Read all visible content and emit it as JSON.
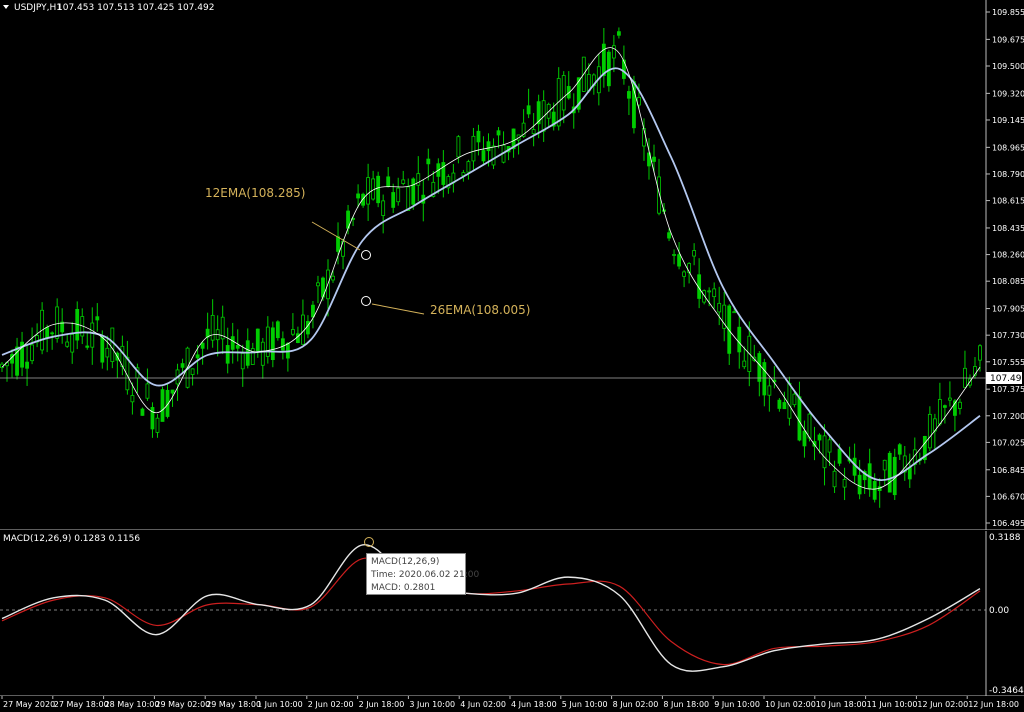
{
  "window": {
    "title": "USDJPY,H1",
    "ohlc": "107.453 107.513 107.425 107.492",
    "menu_icon": "triangle-down-icon"
  },
  "main_price_axis": {
    "ticks": [
      "109.855",
      "109.675",
      "109.500",
      "109.320",
      "109.145",
      "108.965",
      "108.790",
      "108.615",
      "108.435",
      "108.260",
      "108.085",
      "107.905",
      "107.730",
      "107.555",
      "107.375",
      "107.200",
      "107.025",
      "106.845",
      "106.670",
      "106.495"
    ],
    "current_price": "107.492"
  },
  "annotations": {
    "ema12": "12EMA(108.285)",
    "ema26": "26EMA(108.005)"
  },
  "macd_panel": {
    "label": "MACD(12,26,9) 0.1283 0.1156",
    "axis_top": "0.3188",
    "axis_zero": "0.00",
    "axis_bottom": "-0.3464",
    "tooltip": {
      "line1": "MACD(12,26,9)",
      "line2": "Time: 2020.06.02 21:00",
      "line3": "MACD: 0.2801"
    }
  },
  "time_axis": [
    "27 May 2020",
    "27 May 18:00",
    "28 May 10:00",
    "29 May 02:00",
    "29 May 18:00",
    "1 Jun 10:00",
    "2 Jun 02:00",
    "2 Jun 18:00",
    "3 Jun 10:00",
    "4 Jun 02:00",
    "4 Jun 18:00",
    "5 Jun 10:00",
    "8 Jun 02:00",
    "8 Jun 18:00",
    "9 Jun 10:00",
    "10 Jun 02:00",
    "10 Jun 18:00",
    "11 Jun 10:00",
    "12 Jun 02:00",
    "12 Jun 18:00"
  ],
  "colors": {
    "background": "#000000",
    "candle": "#00cc00",
    "ema12": "#ffffff",
    "ema26": "#b4c8f0",
    "macd_main": "#e6e6e6",
    "macd_signal": "#cc1f1f",
    "annotation": "#d4b25a",
    "grid_line": "#aaaaaa"
  },
  "chart_data": {
    "type": "line",
    "title": "USDJPY,H1",
    "x": [
      "27 May 2020",
      "27 May 18:00",
      "28 May 10:00",
      "29 May 02:00",
      "29 May 18:00",
      "1 Jun 10:00",
      "2 Jun 02:00",
      "2 Jun 18:00",
      "3 Jun 10:00",
      "4 Jun 02:00",
      "4 Jun 18:00",
      "5 Jun 10:00",
      "8 Jun 02:00",
      "8 Jun 18:00",
      "9 Jun 10:00",
      "10 Jun 02:00",
      "10 Jun 18:00",
      "11 Jun 10:00",
      "12 Jun 02:00",
      "12 Jun 18:00"
    ],
    "series": [
      {
        "name": "12EMA",
        "values": [
          107.52,
          107.8,
          107.7,
          107.22,
          107.72,
          107.62,
          107.82,
          108.62,
          108.72,
          108.92,
          109.02,
          109.32,
          109.58,
          108.4,
          107.82,
          107.42,
          106.92,
          106.72,
          107.05,
          107.52
        ]
      },
      {
        "name": "26EMA",
        "values": [
          107.6,
          107.72,
          107.72,
          107.4,
          107.6,
          107.62,
          107.7,
          108.35,
          108.58,
          108.78,
          108.98,
          109.18,
          109.48,
          108.9,
          108.05,
          107.55,
          107.1,
          106.78,
          106.95,
          107.2
        ]
      }
    ],
    "macd": {
      "name": "MACD(12,26,9)",
      "main": [
        -0.04,
        0.05,
        0.04,
        -0.11,
        0.06,
        0.02,
        0.02,
        0.28,
        0.11,
        0.07,
        0.07,
        0.14,
        0.06,
        -0.24,
        -0.25,
        -0.18,
        -0.15,
        -0.13,
        -0.04,
        0.09
      ],
      "signal": [
        -0.05,
        0.04,
        0.05,
        -0.07,
        0.02,
        0.02,
        0.01,
        0.22,
        0.13,
        0.07,
        0.08,
        0.11,
        0.1,
        -0.14,
        -0.24,
        -0.17,
        -0.16,
        -0.14,
        -0.07,
        0.08
      ],
      "ylim": [
        -0.3464,
        0.3188
      ]
    },
    "ylim": [
      106.495,
      109.855
    ],
    "grid": false,
    "legend": "none"
  }
}
